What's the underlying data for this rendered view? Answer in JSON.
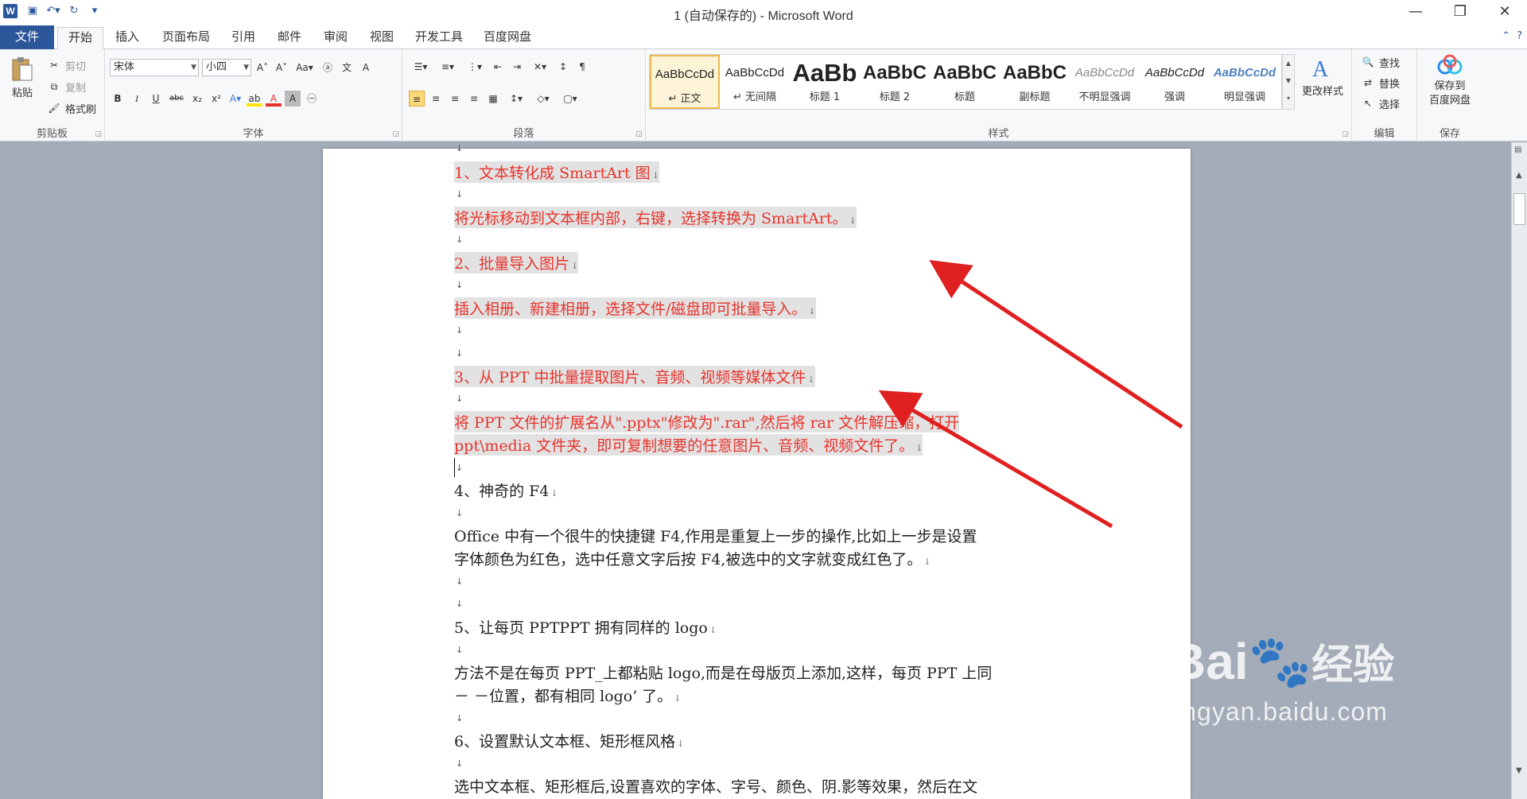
{
  "window": {
    "title": "1 (自动保存的) - Microsoft Word",
    "app_icon": "W"
  },
  "tabs": [
    "文件",
    "开始",
    "插入",
    "页面布局",
    "引用",
    "邮件",
    "审阅",
    "视图",
    "开发工具",
    "百度网盘"
  ],
  "active_tab": "开始",
  "ribbon": {
    "clipboard": {
      "label": "剪贴板",
      "paste": "粘贴",
      "cut": "剪切",
      "copy": "复制",
      "format_painter": "格式刷"
    },
    "font": {
      "label": "字体",
      "font_name": "宋体",
      "font_size": "小四",
      "bold": "B",
      "italic": "I",
      "underline": "U",
      "strike": "abc",
      "sub": "x₂",
      "sup": "x²"
    },
    "paragraph": {
      "label": "段落"
    },
    "styles": {
      "label": "样式",
      "items": [
        {
          "sample": "AaBbCcDd",
          "name": "↵ 正文"
        },
        {
          "sample": "AaBbCcDd",
          "name": "↵ 无间隔"
        },
        {
          "sample": "AaBb",
          "name": "标题 1"
        },
        {
          "sample": "AaBbC",
          "name": "标题 2"
        },
        {
          "sample": "AaBbC",
          "name": "标题"
        },
        {
          "sample": "AaBbC",
          "name": "副标题"
        },
        {
          "sample": "AaBbCcDd",
          "name": "不明显强调"
        },
        {
          "sample": "AaBbCcDd",
          "name": "强调"
        },
        {
          "sample": "AaBbCcDd",
          "name": "明显强调"
        }
      ],
      "change_styles": "更改样式"
    },
    "editing": {
      "label": "编辑",
      "find": "查找",
      "replace": "替换",
      "select": "选择"
    },
    "save": {
      "label": "保存",
      "save_to": "保存到",
      "baidu": "百度网盘"
    }
  },
  "document": {
    "lines": [
      {
        "text": "1、文本转化成 SmartArt 图",
        "red": true
      },
      {
        "text": "将光标移动到文本框内部，右键，选择转换为 SmartArt。",
        "red": true
      },
      {
        "text": "2、批量导入图片",
        "red": true
      },
      {
        "text": "插入相册、新建相册，选择文件/磁盘即可批量导入。",
        "red": true
      },
      {
        "text": "3、从 PPT 中批量提取图片、音频、视频等媒体文件",
        "red": true
      },
      {
        "text": "将 PPT 文件的扩展名从\".pptx\"修改为\".rar\",然后将 rar 文件解压缩，打开",
        "red": true
      },
      {
        "text": "ppt\\media 文件夹，即可复制想要的任意图片、音频、视频文件了。",
        "red": true
      },
      {
        "text": "4、神奇的 F4",
        "red": false
      },
      {
        "text": "Office 中有一个很牛的快捷键 F4,作用是重复上一步的操作,比如上一步是设置",
        "red": false
      },
      {
        "text": "字体颜色为红色，选中任意文字后按 F4,被选中的文字就变成红色了。",
        "red": false
      },
      {
        "text": "5、让每页 PPTPPT 拥有同样的 logo",
        "red": false
      },
      {
        "text": "方法不是在每页 PPT_上都粘贴 logo,而是在母版页上添加,这样，每页 PPT 上同",
        "red": false
      },
      {
        "text": "－ －位置，都有相同 logo’  了。",
        "red": false
      },
      {
        "text": "6、设置默认文本框、矩形框风格",
        "red": false
      },
      {
        "text": "选中文本框、矩形框后,设置喜欢的字体、字号、颜色、阴.影等效果，然后在文",
        "red": false
      }
    ],
    "para_mark": "↓"
  },
  "watermark": {
    "brand": "Bai",
    "brand2": "经验",
    "url": "jingyan.baidu.com"
  },
  "colors": {
    "accent": "#2b579a",
    "red_text": "#e8332c",
    "arrow": "#e02020"
  }
}
